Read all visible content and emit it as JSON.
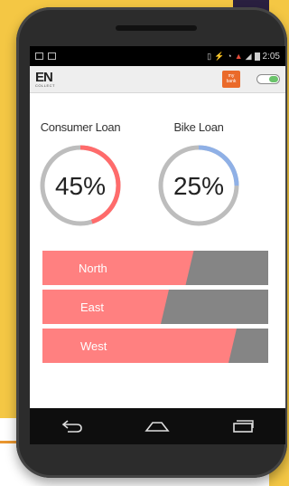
{
  "status_bar": {
    "time": "2:05"
  },
  "app_bar": {
    "logo_main": "EN",
    "logo_sub": "COLLECT",
    "bank_line1": "my",
    "bank_line2": "bank"
  },
  "gauges": [
    {
      "title": "Consumer Loan",
      "percent_label": "45%",
      "percent": 45,
      "color": "#ff6b6b"
    },
    {
      "title": "Bike Loan",
      "percent_label": "25%",
      "percent": 25,
      "color": "#8fb0e6"
    }
  ],
  "regions": [
    {
      "label": "North",
      "fill_fraction": 0.67
    },
    {
      "label": "East",
      "fill_fraction": 0.56
    },
    {
      "label": "West",
      "fill_fraction": 0.86
    }
  ],
  "colors": {
    "track": "#bdbdbd",
    "bar_fill": "#ff8080",
    "bar_rest": "#858585",
    "accent_toggle": "#6ac36b"
  },
  "icons": {
    "nav": [
      "back-icon",
      "home-icon",
      "recent-apps-icon"
    ]
  }
}
